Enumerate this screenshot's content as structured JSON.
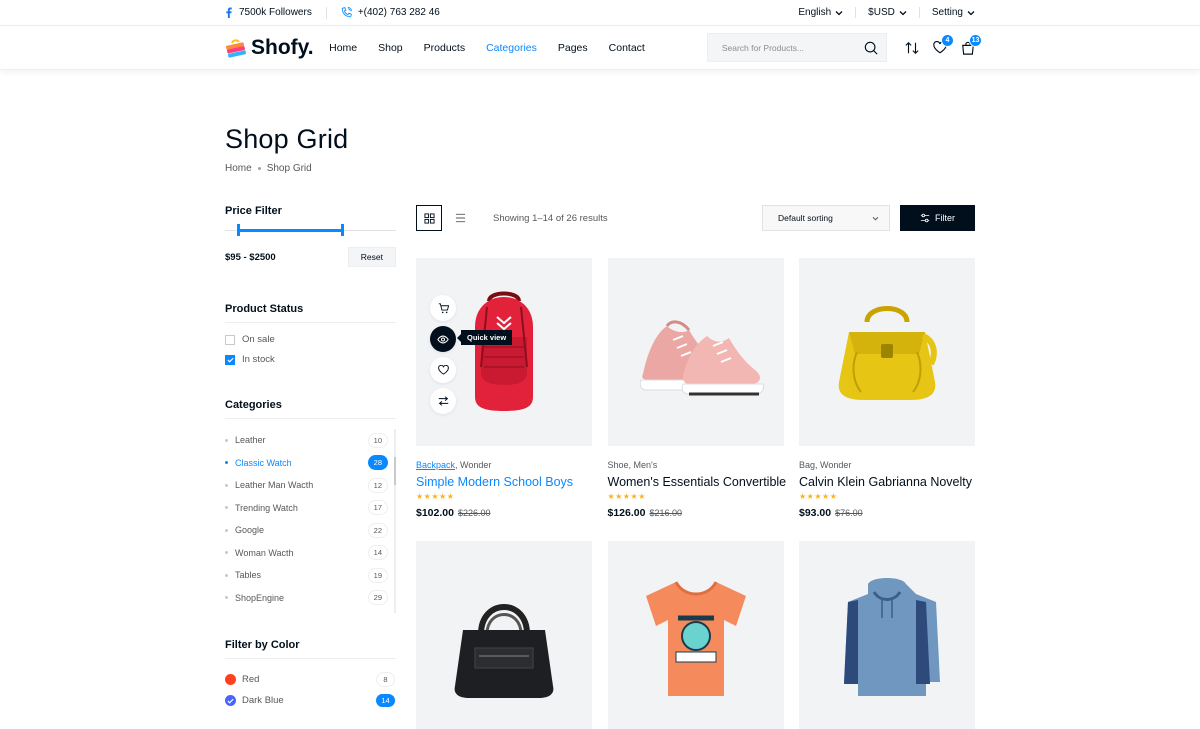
{
  "topbar": {
    "followers": "7500k Followers",
    "phone": "+(402) 763 282 46",
    "language": "English",
    "currency": "$USD",
    "setting": "Setting"
  },
  "header": {
    "brand": "Shofy.",
    "nav": [
      "Home",
      "Shop",
      "Products",
      "Categories",
      "Pages",
      "Contact"
    ],
    "active_nav": "Categories",
    "search_placeholder": "Search for Products...",
    "wishlist_count": "4",
    "cart_count": "13"
  },
  "page": {
    "title": "Shop Grid",
    "breadcrumb": [
      "Home",
      "Shop Grid"
    ]
  },
  "sidebar": {
    "price_filter": {
      "title": "Price Filter",
      "range": "$95 - $2500",
      "reset_label": "Reset"
    },
    "status": {
      "title": "Product Status",
      "items": [
        {
          "label": "On sale",
          "checked": false
        },
        {
          "label": "In stock",
          "checked": true
        }
      ]
    },
    "categories": {
      "title": "Categories",
      "items": [
        {
          "label": "Leather",
          "count": "10"
        },
        {
          "label": "Classic Watch",
          "count": "28",
          "active": true
        },
        {
          "label": "Leather Man Wacth",
          "count": "12"
        },
        {
          "label": "Trending Watch",
          "count": "17"
        },
        {
          "label": "Google",
          "count": "22"
        },
        {
          "label": "Woman Wacth",
          "count": "14"
        },
        {
          "label": "Tables",
          "count": "19"
        },
        {
          "label": "ShopEngine",
          "count": "29"
        }
      ]
    },
    "colors": {
      "title": "Filter by Color",
      "items": [
        {
          "label": "Red",
          "count": "8",
          "color": "#ff401f"
        },
        {
          "label": "Dark Blue",
          "count": "14",
          "color": "#4666ff",
          "active": true
        }
      ]
    }
  },
  "toolbar": {
    "showing": "Showing 1–14 of 26 results",
    "sort": "Default sorting",
    "filter_label": "Filter"
  },
  "products": [
    {
      "cat1": "Backpack",
      "cat2": "Wonder",
      "title": "Simple Modern School Boys",
      "price": "$102.00",
      "old": "$226.00"
    },
    {
      "cat1": "Shoe",
      "cat2": "Men's",
      "title": "Women's Essentials Convertible",
      "price": "$126.00",
      "old": "$216.00"
    },
    {
      "cat1": "Bag",
      "cat2": "Wonder",
      "title": "Calvin Klein Gabrianna Novelty",
      "price": "$93.00",
      "old": "$76.00"
    }
  ],
  "tooltip": "Quick view",
  "colors": {
    "accent": "#0989ff",
    "dark": "#010f1c",
    "star": "#ffb21d"
  }
}
